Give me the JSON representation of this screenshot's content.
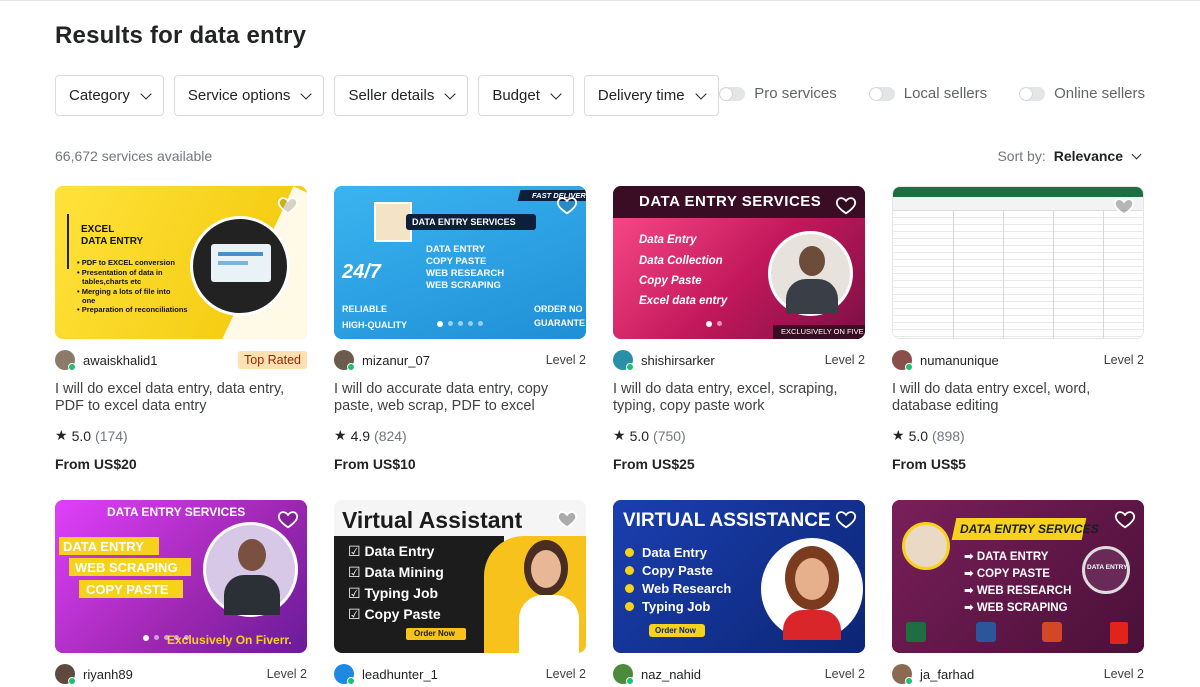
{
  "header": {
    "results_prefix": "Results for",
    "query": "data entry"
  },
  "filters": [
    {
      "label": "Category"
    },
    {
      "label": "Service options"
    },
    {
      "label": "Seller details"
    },
    {
      "label": "Budget"
    },
    {
      "label": "Delivery time"
    }
  ],
  "toggles": [
    {
      "label": "Pro services"
    },
    {
      "label": "Local sellers"
    },
    {
      "label": "Online sellers"
    }
  ],
  "results": {
    "count_text": "66,672 services available",
    "sort_label": "Sort by:",
    "sort_value": "Relevance"
  },
  "gigs": [
    {
      "seller": "awaiskhalid1",
      "badge": "Top Rated",
      "level": "",
      "title": "I will do excel data entry, data entry, PDF to excel data entry",
      "rating": "5.0",
      "reviews": "(174)",
      "price": "From US$20",
      "thumb_text": [
        "EXCEL",
        "DATA ENTRY",
        "• PDF to EXCEL conversion",
        "• Presentation of data in",
        "tables,charts etc",
        "• Merging a lots of file into",
        "one",
        "• Preparation of reconciliations"
      ]
    },
    {
      "seller": "mizanur_07",
      "badge": "",
      "level": "Level 2",
      "title": "I will do accurate data entry, copy paste, web scrap, PDF to excel",
      "rating": "4.9",
      "reviews": "(824)",
      "price": "From US$10",
      "thumb_text": [
        "DATA ENTRY SERVICES",
        "DATA ENTRY",
        "COPY PASTE",
        "WEB RESEARCH",
        "WEB SCRAPING",
        "24/7",
        "RELIABLE",
        "HIGH-QUALITY",
        "ORDER NO",
        "GUARANTE",
        "FAST DELIVER"
      ]
    },
    {
      "seller": "shishirsarker",
      "badge": "",
      "level": "Level 2",
      "title": "I will do data entry, excel, scraping, typing, copy paste work",
      "rating": "5.0",
      "reviews": "(750)",
      "price": "From US$25",
      "thumb_text": [
        "DATA ENTRY SERVICES",
        "Data Entry",
        "Data Collection",
        "Copy Paste",
        "Excel data entry",
        "EXCLUSIVELY ON FIVE"
      ]
    },
    {
      "seller": "numanunique",
      "badge": "",
      "level": "Level 2",
      "title": "I will do data entry excel, word, database editing",
      "rating": "5.0",
      "reviews": "(898)",
      "price": "From US$5",
      "thumb_text": []
    },
    {
      "seller": "riyanh89",
      "badge": "",
      "level": "Level 2",
      "title": "",
      "rating": "",
      "reviews": "",
      "price": "",
      "thumb_text": [
        "DATA ENTRY SERVICES",
        "DATA ENTRY",
        "WEB SCRAPING",
        "COPY PASTE",
        "Exclusively On Fiverr."
      ]
    },
    {
      "seller": "leadhunter_1",
      "badge": "",
      "level": "Level 2",
      "title": "",
      "rating": "",
      "reviews": "",
      "price": "",
      "thumb_text": [
        "Virtual Assistant",
        "☑ Data Entry",
        "☑ Data Mining",
        "☑ Typing Job",
        "☑ Copy Paste",
        "Order Now"
      ]
    },
    {
      "seller": "naz_nahid",
      "badge": "",
      "level": "Level 2",
      "title": "",
      "rating": "",
      "reviews": "",
      "price": "",
      "thumb_text": [
        "VIRTUAL ASSISTANCE",
        "Data Entry",
        "Copy Paste",
        "Web Research",
        "Typing Job",
        "Order Now"
      ]
    },
    {
      "seller": "ja_farhad",
      "badge": "",
      "level": "Level 2",
      "title": "",
      "rating": "",
      "reviews": "",
      "price": "",
      "thumb_text": [
        "DATA ENTRY SERVICES",
        "➡ DATA ENTRY",
        "➡ COPY PASTE",
        "➡ WEB RESEARCH",
        "➡ WEB SCRAPING",
        "DATA ENTRY"
      ]
    }
  ],
  "colors": {
    "accent": "#1dbf73",
    "badge_bg": "#ffe0b3",
    "badge_text": "#8f2900"
  },
  "icons": {
    "heart": "heart-icon",
    "star": "star-icon",
    "chevron": "chevron-down-icon"
  }
}
